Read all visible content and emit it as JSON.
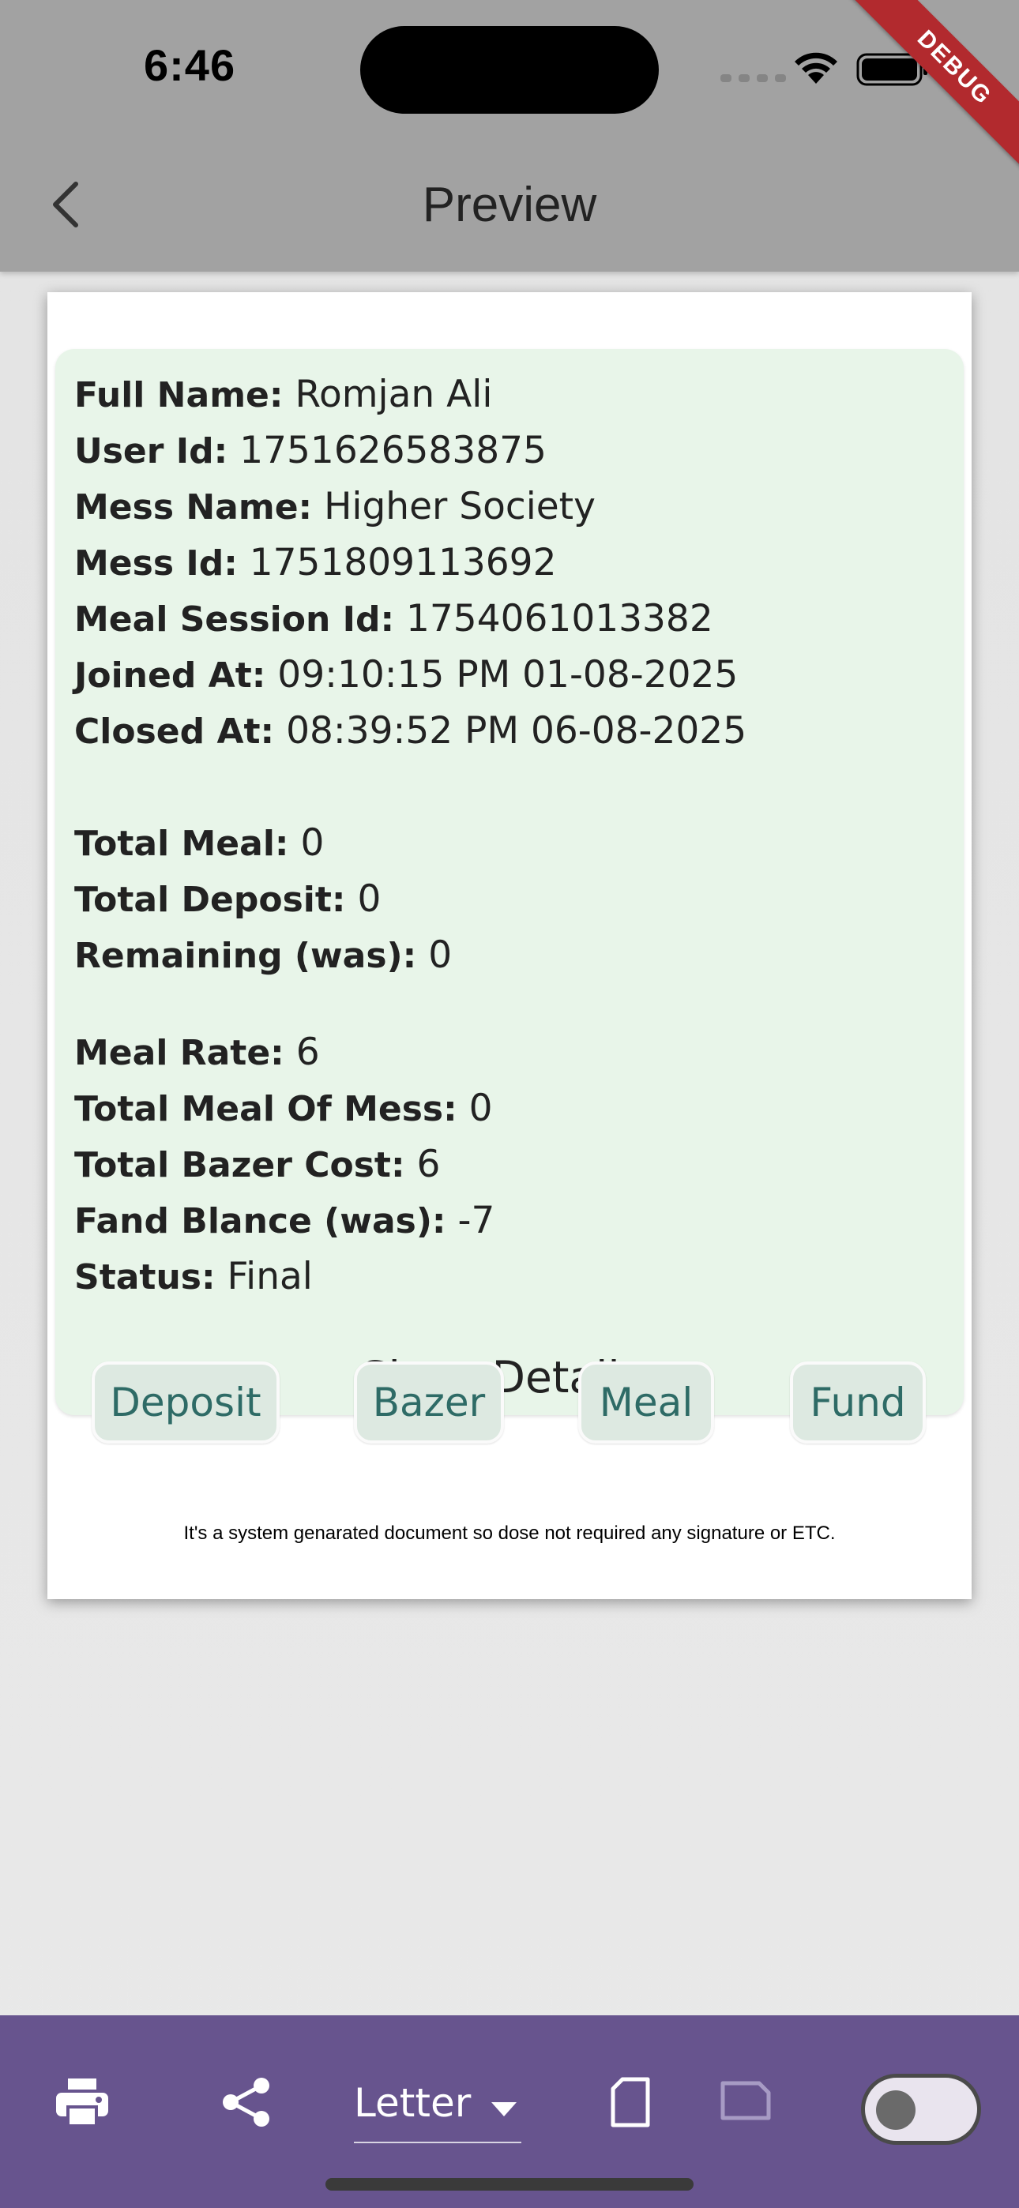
{
  "status_bar": {
    "time": "6:46",
    "debug_label": "DEBUG"
  },
  "app_bar": {
    "title": "Preview",
    "back_icon": "chevron-left-icon"
  },
  "document": {
    "identity": [
      {
        "label": "Full Name:",
        "value": "Romjan Ali"
      },
      {
        "label": "User Id:",
        "value": "1751626583875"
      },
      {
        "label": "Mess Name:",
        "value": "Higher Society"
      },
      {
        "label": "Mess Id:",
        "value": "1751809113692"
      },
      {
        "label": "Meal Session Id:",
        "value": "1754061013382"
      },
      {
        "label": "Joined At:",
        "value": "09:10:15 PM 01-08-2025"
      },
      {
        "label": "Closed At:",
        "value": "08:39:52 PM 06-08-2025"
      }
    ],
    "personal_totals": [
      {
        "label": "Total Meal:",
        "value": "0"
      },
      {
        "label": "Total Deposit:",
        "value": "0"
      },
      {
        "label": "Remaining (was):",
        "value": "0"
      }
    ],
    "mess_totals": [
      {
        "label": "Meal Rate:",
        "value": "6"
      },
      {
        "label": "Total Meal Of Mess:",
        "value": "0"
      },
      {
        "label": "Total Bazer Cost:",
        "value": "6"
      },
      {
        "label": "Fand Blance (was):",
        "value": "-7"
      },
      {
        "label": "Status:",
        "value": "Final"
      }
    ],
    "show_details_label": "Show Details-",
    "buttons": {
      "deposit": "Deposit",
      "bazer": "Bazer",
      "meal": "Meal",
      "fund": "Fund"
    },
    "footer_note": "It's a system genarated document so dose not required any signature or ETC."
  },
  "toolbar": {
    "paper_size": "Letter",
    "icons": [
      "print-icon",
      "share-icon",
      "portrait-icon",
      "landscape-icon"
    ],
    "toggle_on": false
  },
  "colors": {
    "app_bar": "#a2a2a2",
    "card_bg": "#e8f5e9",
    "button_text": "#2e6b66",
    "toolbar_bg": "#67548e",
    "debug_ribbon": "#b22a2e"
  }
}
